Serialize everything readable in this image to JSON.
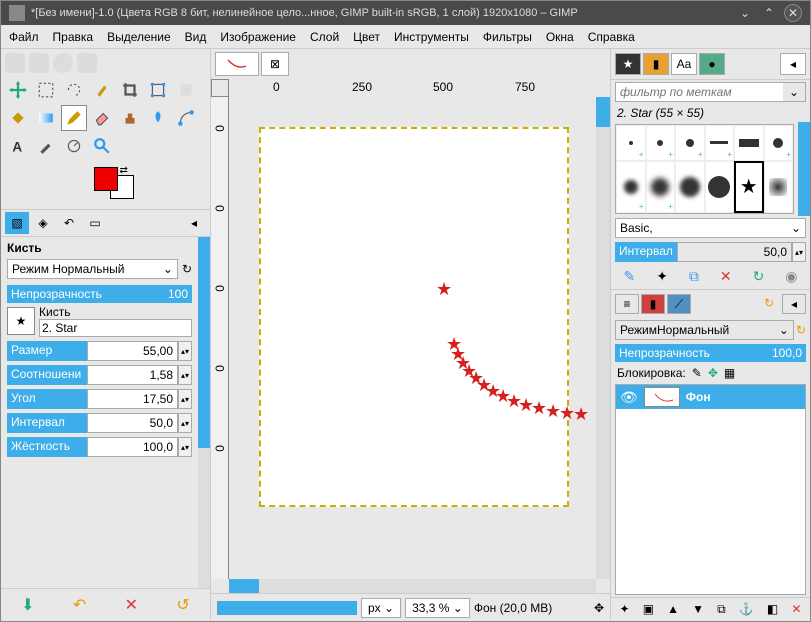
{
  "title": "*[Без имени]-1.0 (Цвета RGB 8 бит, нелинейное цело...нное, GIMP built-in sRGB, 1 слой) 1920x1080 – GIMP",
  "menu": [
    "Файл",
    "Правка",
    "Выделение",
    "Вид",
    "Изображение",
    "Слой",
    "Цвет",
    "Инструменты",
    "Фильтры",
    "Окна",
    "Справка"
  ],
  "options": {
    "title": "Кисть",
    "mode_label": "Режим",
    "mode_value": "Нормальный",
    "opacity_label": "Непрозрачность",
    "opacity_value": "100",
    "brush_label": "Кисть",
    "brush_name": "2. Star",
    "size_label": "Размер",
    "size_value": "55,00",
    "ratio_label": "Соотношени",
    "ratio_value": "1,58",
    "angle_label": "Угол",
    "angle_value": "17,50",
    "spacing_label": "Интервал",
    "spacing_value": "50,0",
    "hardness_label": "Жёсткость",
    "hardness_value": "100,0"
  },
  "ruler_h": {
    "0": "0",
    "250": "250",
    "500": "500",
    "750": "750"
  },
  "status": {
    "unit": "px",
    "zoom": "33,3 %",
    "layer": "Фон (20,0 MB)"
  },
  "brushes": {
    "filter_placeholder": "фильтр по меткам",
    "current": "2. Star (55 × 55)",
    "preset": "Basic,",
    "interval_label": "Интервал",
    "interval_value": "50,0"
  },
  "layers": {
    "mode_label": "Режим",
    "mode_value": "Нормальный",
    "opacity_label": "Непрозрачность",
    "opacity_value": "100,0",
    "lock_label": "Блокировка:",
    "layer_name": "Фон"
  }
}
